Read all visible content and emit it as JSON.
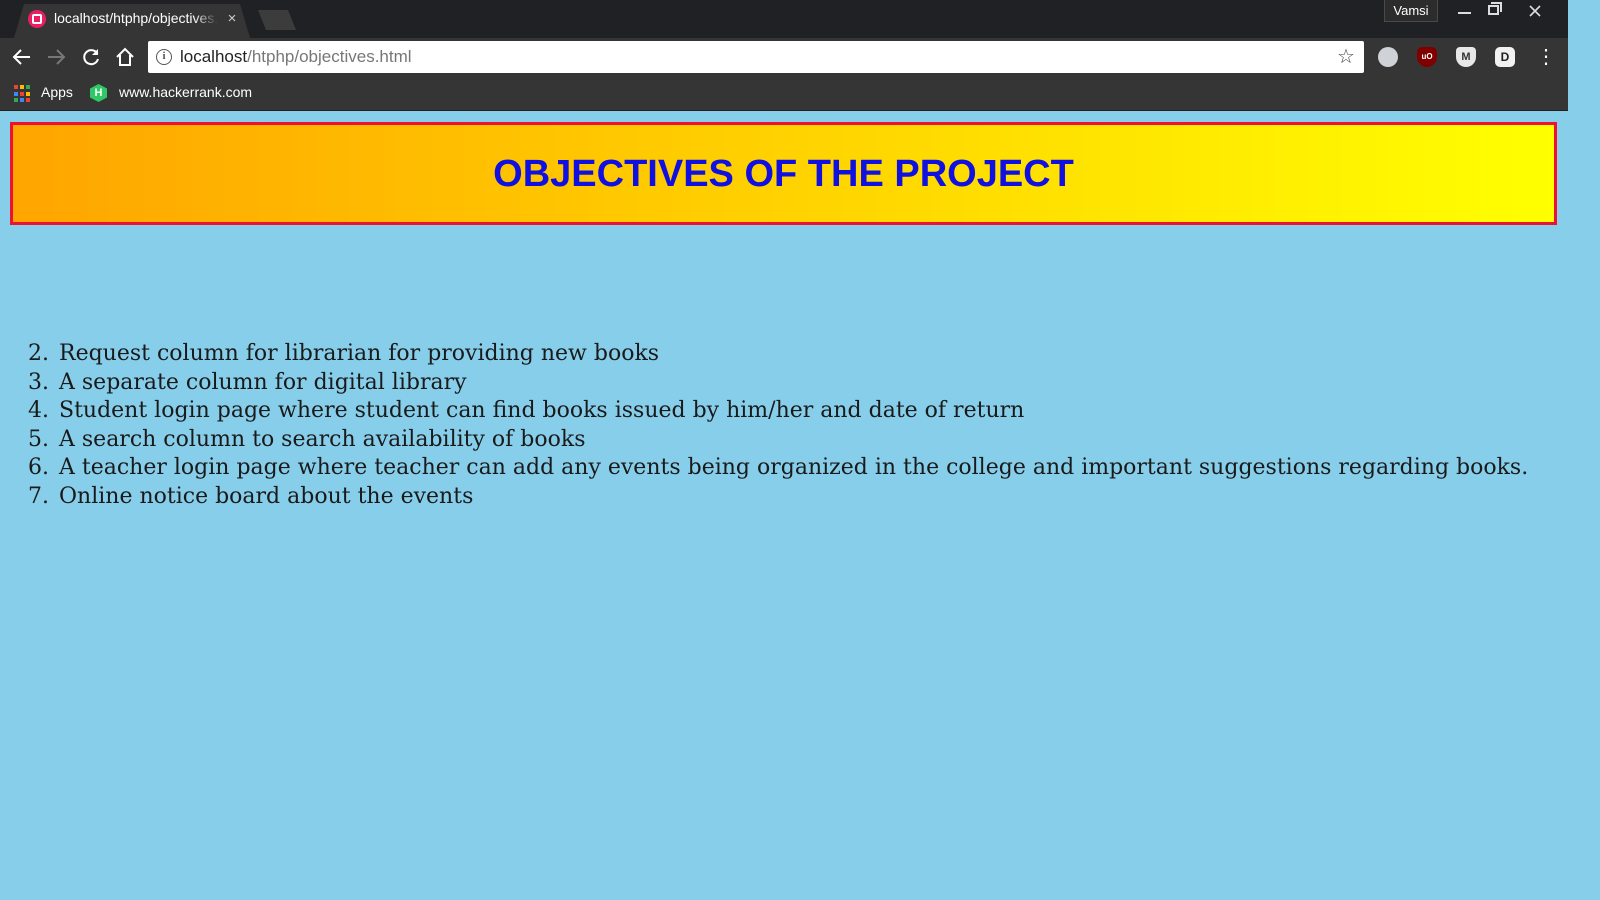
{
  "browser": {
    "tab_title": "localhost/htphp/objectives.html",
    "tab_close": "×",
    "profile_name": "Vamsi",
    "url_host": "localhost",
    "url_path": "/htphp/objectives.html",
    "info_glyph": "i",
    "back_icon": "back-arrow-icon",
    "forward_icon": "forward-arrow-icon",
    "reload_icon": "reload-icon",
    "home_icon": "home-icon",
    "bookmarks": [
      {
        "label": "Apps",
        "icon": "apps-grid-icon"
      },
      {
        "label": "www.hackerrank.com",
        "icon": "hackerrank-icon"
      }
    ],
    "extensions": [
      "cloud-extension-icon",
      "ublock-icon",
      "shield-extension-icon",
      "box-extension-icon"
    ],
    "ublock_text": "uO",
    "shield_text": "M",
    "box_text": "D"
  },
  "page": {
    "title": "OBJECTIVES OF THE PROJECT",
    "background": "#87ceeb",
    "banner_gradient": [
      "#ffa500",
      "#ffff00"
    ],
    "banner_border": "#ee1133",
    "title_color": "#1010e0",
    "objectives": [
      {
        "num": "2.",
        "text": "Request column for librarian for providing new books"
      },
      {
        "num": "3.",
        "text": "A separate column for digital library"
      },
      {
        "num": "4.",
        "text": "Student login page where student can find books issued by him/her and date of return"
      },
      {
        "num": "5.",
        "text": "A search column to search availability of books"
      },
      {
        "num": "6.",
        "text": "A teacher login page where teacher can add any events being organized in the college and important suggestions regarding books."
      },
      {
        "num": "7.",
        "text": "Online notice board about the events"
      }
    ]
  }
}
